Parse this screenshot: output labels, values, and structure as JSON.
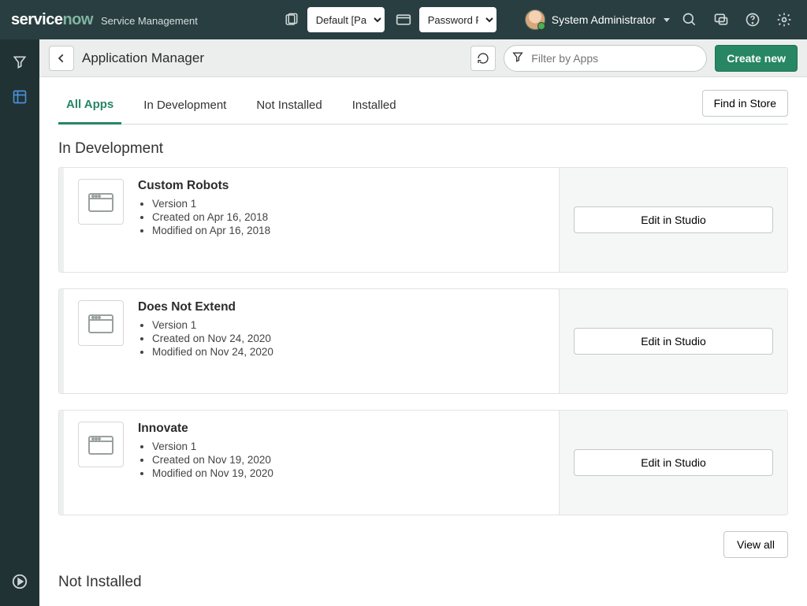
{
  "brand": {
    "logo1": "service",
    "logo2": "now",
    "subtitle": "Service Management"
  },
  "pickers": {
    "app": "Default [Pas",
    "updateSet": "Password Re"
  },
  "user": {
    "name": "System Administrator"
  },
  "header": {
    "title": "Application Manager",
    "filterPlaceholder": "Filter by Apps",
    "create": "Create new"
  },
  "tabs": {
    "allApps": "All Apps",
    "inDev": "In Development",
    "notInstalled": "Not Installed",
    "installed": "Installed",
    "findStore": "Find in Store"
  },
  "sections": {
    "inDev": "In Development",
    "notInstalled": "Not Installed"
  },
  "apps": [
    {
      "name": "Custom Robots",
      "version": "Version 1",
      "created": "Created on Apr 16, 2018",
      "modified": "Modified on Apr 16, 2018",
      "action": "Edit in Studio"
    },
    {
      "name": "Does Not Extend",
      "version": "Version 1",
      "created": "Created on Nov 24, 2020",
      "modified": "Modified on Nov 24, 2020",
      "action": "Edit in Studio"
    },
    {
      "name": "Innovate",
      "version": "Version 1",
      "created": "Created on Nov 19, 2020",
      "modified": "Modified on Nov 19, 2020",
      "action": "Edit in Studio"
    }
  ],
  "viewAll": "View all"
}
